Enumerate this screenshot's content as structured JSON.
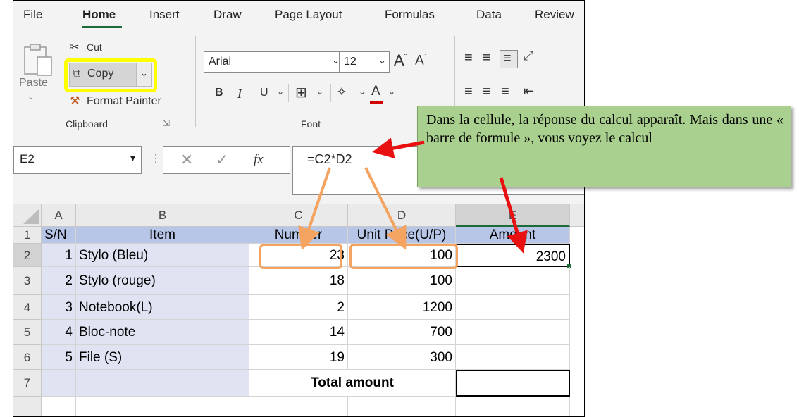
{
  "menu": {
    "tabs": [
      "File",
      "Home",
      "Insert",
      "Draw",
      "Page Layout",
      "Formulas",
      "Data",
      "Review"
    ],
    "active_tab": "Home"
  },
  "ribbon": {
    "clipboard": {
      "paste_label": "Paste",
      "cut_label": "Cut",
      "copy_label": "Copy",
      "format_painter_label": "Format Painter",
      "group_label": "Clipboard"
    },
    "font": {
      "font_name": "Arial",
      "font_size": "12",
      "bold": "B",
      "italic": "I",
      "underline": "U",
      "font_color_letter": "A",
      "group_label": "Font"
    }
  },
  "formula_bar": {
    "name_box": "E2",
    "fx_label": "fx",
    "formula": "=C2*D2"
  },
  "sheet": {
    "column_headers": [
      "A",
      "B",
      "C",
      "D",
      "E"
    ],
    "row_headers": [
      "1",
      "2",
      "3",
      "4",
      "5",
      "6",
      "7"
    ],
    "header_row": [
      "S/N",
      "Item",
      "Number",
      "Unit Price(U/P)",
      "Amount"
    ],
    "rows": [
      [
        "1",
        "Stylo (Bleu)",
        "23",
        "100",
        "2300"
      ],
      [
        "2",
        "Stylo (rouge)",
        "18",
        "100",
        ""
      ],
      [
        "3",
        "Notebook(L)",
        "2",
        "1200",
        ""
      ],
      [
        "4",
        "Bloc-note",
        "14",
        "700",
        ""
      ],
      [
        "5",
        "File (S)",
        "19",
        "300",
        ""
      ]
    ],
    "total_label": "Total amount",
    "selected_cell": "E2"
  },
  "callout": {
    "text": "Dans la cellule, la réponse du calcul apparaît. Mais dans une « barre de formule », vous voyez le calcul"
  },
  "colors": {
    "highlight_yellow": "#ffff00",
    "arrow_orange": "#f4a460",
    "arrow_red": "#e81010",
    "callout_green": "#a9d08e",
    "header_blue": "#b7c6e6",
    "row_blue": "#dfe3f2"
  }
}
